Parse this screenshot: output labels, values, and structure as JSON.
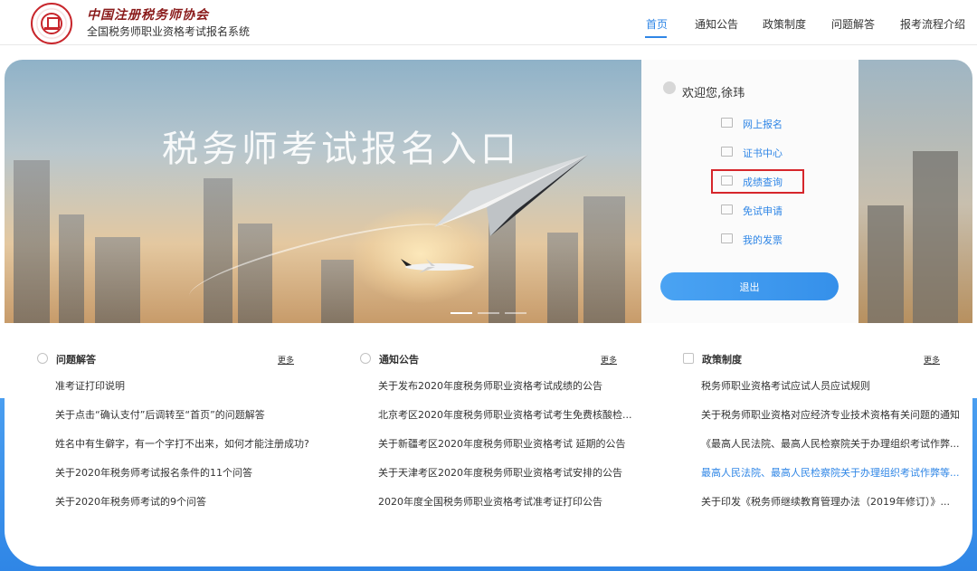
{
  "header": {
    "org_calligraphy": "中国注册税务师协会",
    "system_title": "全国税务师职业资格考试报名系统",
    "nav": [
      {
        "label": "首页",
        "active": true
      },
      {
        "label": "通知公告",
        "active": false
      },
      {
        "label": "政策制度",
        "active": false
      },
      {
        "label": "问题解答",
        "active": false
      },
      {
        "label": "报考流程介绍",
        "active": false
      }
    ]
  },
  "banner": {
    "title": "税务师考试报名入口",
    "slides": 3,
    "active_slide": 0
  },
  "user_panel": {
    "welcome": "欢迎您,徐玮",
    "menu": [
      {
        "label": "网上报名",
        "icon": "monitor-icon"
      },
      {
        "label": "证书中心",
        "icon": "certificate-icon"
      },
      {
        "label": "成绩查询",
        "icon": "score-icon",
        "highlighted": true
      },
      {
        "label": "免试申请",
        "icon": "edit-form-icon"
      },
      {
        "label": "我的发票",
        "icon": "invoice-icon"
      }
    ],
    "logout_label": "退出"
  },
  "sections": [
    {
      "title": "问题解答",
      "icon": "question-icon",
      "more": "更多",
      "items": [
        {
          "text": "准考证打印说明"
        },
        {
          "text": "关于点击“确认支付”后调转至“首页”的问题解答"
        },
        {
          "text": "姓名中有生僻字，有一个字打不出来，如何才能注册成功?"
        },
        {
          "text": "关于2020年税务师考试报名条件的11个问答"
        },
        {
          "text": "关于2020年税务师考试的9个问答"
        }
      ]
    },
    {
      "title": "通知公告",
      "icon": "notice-icon",
      "more": "更多",
      "items": [
        {
          "text": "关于发布2020年度税务师职业资格考试成绩的公告"
        },
        {
          "text": "北京考区2020年度税务师职业资格考试考生免费核酸检..."
        },
        {
          "text": "关于新疆考区2020年度税务师职业资格考试 延期的公告"
        },
        {
          "text": "关于天津考区2020年度税务师职业资格考试安排的公告"
        },
        {
          "text": "2020年度全国税务师职业资格考试准考证打印公告"
        }
      ]
    },
    {
      "title": "政策制度",
      "icon": "policy-icon",
      "more": "更多",
      "items": [
        {
          "text": "税务师职业资格考试应试人员应试规则"
        },
        {
          "text": "关于税务师职业资格对应经济专业技术资格有关问题的通知"
        },
        {
          "text": "《最高人民法院、最高人民检察院关于办理组织考试作弊..."
        },
        {
          "text": "最高人民法院、最高人民检察院关于办理组织考试作弊等...",
          "link": true
        },
        {
          "text": "关于印发《税务师继续教育管理办法（2019年修订）》..."
        }
      ]
    }
  ],
  "colors": {
    "accent": "#2f86e6",
    "highlight_border": "#d6262b",
    "seal": "#c8262c"
  }
}
